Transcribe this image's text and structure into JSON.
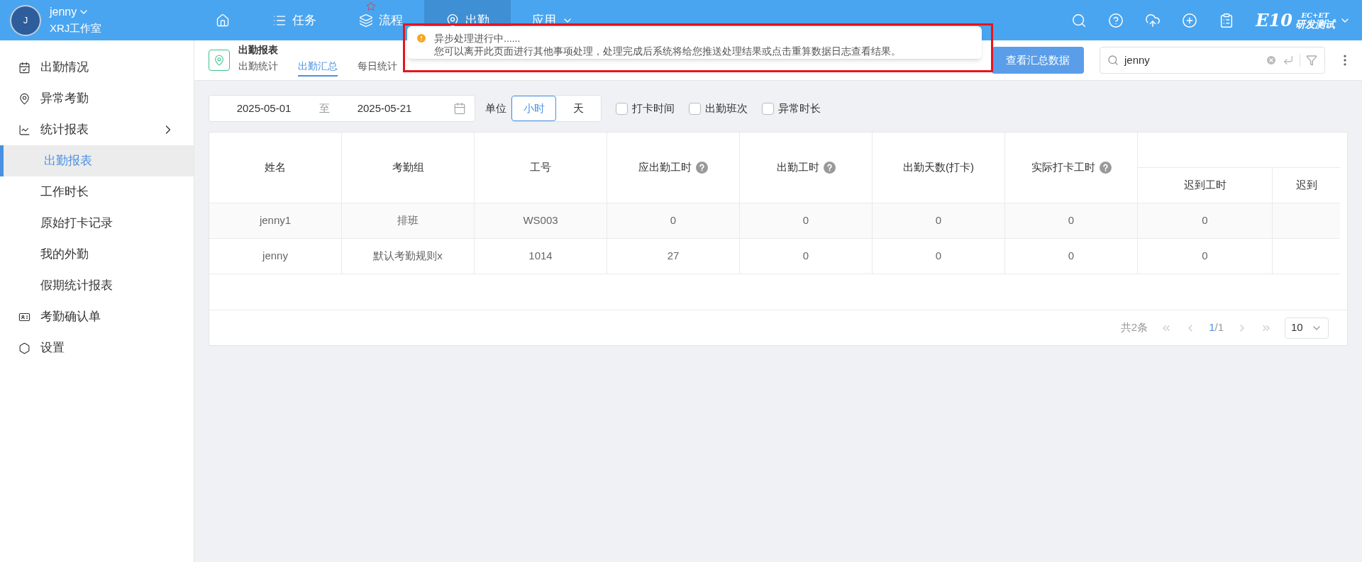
{
  "user": {
    "avatar_letter": "J",
    "name": "jenny",
    "org": "XRJ工作室"
  },
  "nav": [
    {
      "kind": "home",
      "selected": false
    },
    {
      "kind": "list",
      "label": "任务",
      "selected": false
    },
    {
      "kind": "layers",
      "label": "流程",
      "selected": false,
      "starred": true
    },
    {
      "kind": "pin",
      "label": "出勤",
      "selected": true
    },
    {
      "kind": "caret",
      "label": "应用",
      "selected": false
    }
  ],
  "logo": {
    "main": "E10",
    "top": "EC+ET",
    "bottom": "研发测试"
  },
  "toast": {
    "title": "异步处理进行中......",
    "message": "您可以离开此页面进行其他事项处理，处理完成后系统将给您推送处理结果或点击重算数据日志查看结果。"
  },
  "sidebar": {
    "items": [
      {
        "label": "出勤情况",
        "selected": false
      },
      {
        "label": "异常考勤",
        "selected": false
      },
      {
        "label": "统计报表",
        "selected": false,
        "children": [
          {
            "label": "出勤报表",
            "selected": true
          },
          {
            "label": "工作时长",
            "selected": false
          },
          {
            "label": "原始打卡记录",
            "selected": false
          },
          {
            "label": "我的外勤",
            "selected": false
          },
          {
            "label": "假期统计报表",
            "selected": false
          }
        ]
      },
      {
        "label": "考勤确认单",
        "selected": false
      },
      {
        "label": "设置",
        "selected": false
      }
    ]
  },
  "page": {
    "title": "出勤报表",
    "tabs": [
      {
        "label": "出勤统计",
        "selected": false
      },
      {
        "label": "出勤汇总",
        "selected": true
      },
      {
        "label": "每日统计",
        "selected": false
      }
    ],
    "summary_button": "查看汇总数据",
    "search": {
      "value": "jenny"
    }
  },
  "filters": {
    "date_from": "2025-05-01",
    "separator": "至",
    "date_to": "2025-05-21",
    "unit_label": "单位",
    "units": [
      {
        "label": "小时",
        "selected": true
      },
      {
        "label": "天",
        "selected": false
      }
    ],
    "checkboxes": [
      {
        "label": "打卡时间",
        "checked": false
      },
      {
        "label": "出勤班次",
        "checked": false
      },
      {
        "label": "异常时长",
        "checked": false
      }
    ]
  },
  "table": {
    "columns": [
      {
        "label": "姓名",
        "help": false
      },
      {
        "label": "考勤组",
        "help": false
      },
      {
        "label": "工号",
        "help": false
      },
      {
        "label": "应出勤工时",
        "help": true
      },
      {
        "label": "出勤工时",
        "help": true
      },
      {
        "label": "出勤天数(打卡)",
        "help": false
      },
      {
        "label": "实际打卡工时",
        "help": true
      }
    ],
    "sub_columns": [
      "迟到工时",
      "迟到"
    ],
    "rows": [
      {
        "cells": [
          "jenny1",
          "排班",
          "WS003",
          "0",
          "0",
          "0",
          "0",
          "0"
        ]
      },
      {
        "cells": [
          "jenny",
          "默认考勤规则x",
          "1014",
          "27",
          "0",
          "0",
          "0",
          "0"
        ]
      }
    ]
  },
  "pagination": {
    "total": "共2条",
    "page": "1",
    "pages": "/1",
    "page_size": "10"
  }
}
